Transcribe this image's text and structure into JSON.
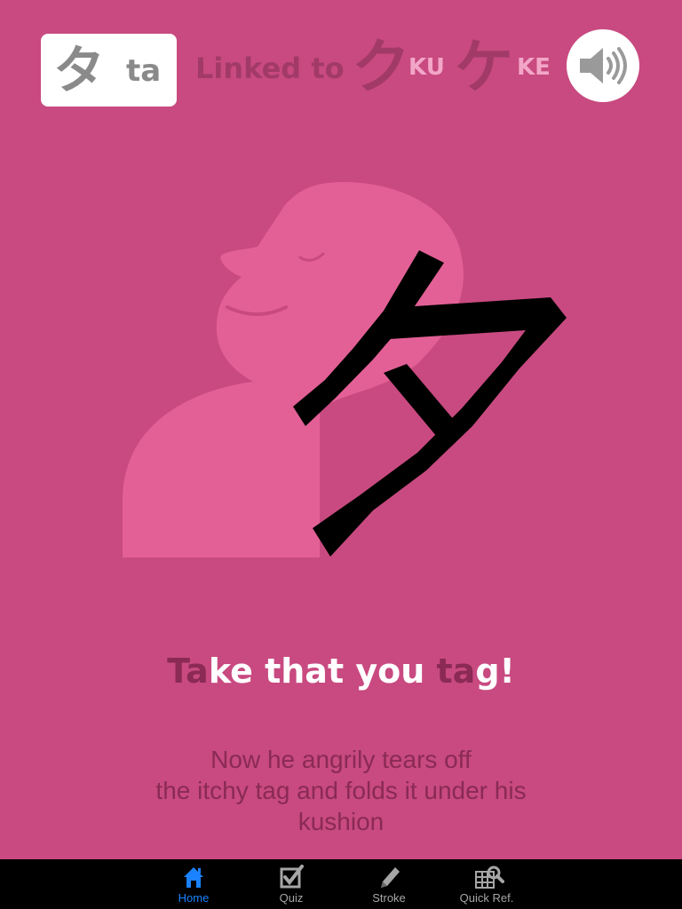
{
  "header": {
    "current_kana": "タ",
    "current_romaji": "ta",
    "linked_label": "Linked to",
    "links": [
      {
        "kana": "ク",
        "romaji": "KU"
      },
      {
        "kana": "ケ",
        "romaji": "KE"
      }
    ],
    "sound_icon": "speaker-icon"
  },
  "illustration": {
    "kana_glyph": "タ",
    "figure": "pink-person-silhouette"
  },
  "mnemonic": {
    "parts": [
      {
        "text": "Ta",
        "highlight": true
      },
      {
        "text": "ke that you ",
        "highlight": false
      },
      {
        "text": "ta",
        "highlight": true
      },
      {
        "text": "g!",
        "highlight": false
      }
    ]
  },
  "description": {
    "lines": [
      "Now he angrily tears off",
      "the itchy tag and folds it under his",
      "kushion"
    ]
  },
  "tabbar": {
    "tabs": [
      {
        "label": "Home",
        "icon": "home-icon",
        "active": true
      },
      {
        "label": "Quiz",
        "icon": "checkbox-icon",
        "active": false
      },
      {
        "label": "Stroke",
        "icon": "pencil-icon",
        "active": false
      },
      {
        "label": "Quick Ref.",
        "icon": "grid-search-icon",
        "active": false
      }
    ]
  },
  "colors": {
    "background": "#c84a80",
    "figure": "#e36096",
    "accent_dark": "#8a2a55",
    "tab_active": "#1a82ff"
  }
}
